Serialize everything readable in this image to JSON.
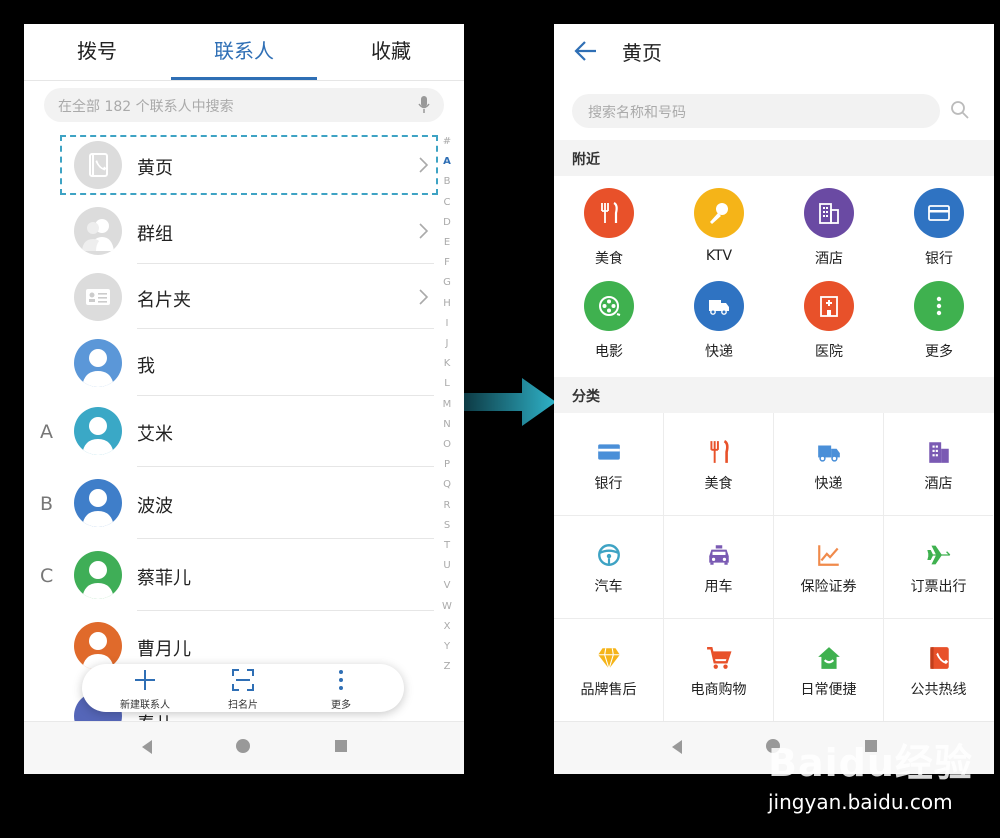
{
  "left": {
    "tabs": [
      {
        "label": "拨号"
      },
      {
        "label": "联系人"
      },
      {
        "label": "收藏"
      }
    ],
    "search_placeholder": "在全部 182 个联系人中搜索",
    "rows": [
      {
        "name": "黄页",
        "letter": "",
        "icon": "yellow-pages-icon"
      },
      {
        "name": "群组",
        "letter": "",
        "icon": "group-icon"
      },
      {
        "name": "名片夹",
        "letter": "",
        "icon": "business-card-icon"
      },
      {
        "name": "我",
        "letter": "",
        "icon": "person-avatar"
      },
      {
        "name": "艾米",
        "letter": "A",
        "icon": "person-avatar"
      },
      {
        "name": "波波",
        "letter": "B",
        "icon": "person-avatar"
      },
      {
        "name": "蔡菲儿",
        "letter": "C",
        "icon": "person-avatar"
      },
      {
        "name": "曹月儿",
        "letter": "",
        "icon": "person-avatar"
      },
      {
        "name": "春儿",
        "letter": "",
        "icon": "person-avatar"
      }
    ],
    "index_letters": [
      "#",
      "A",
      "B",
      "C",
      "D",
      "E",
      "F",
      "G",
      "H",
      "I",
      "J",
      "K",
      "L",
      "M",
      "N",
      "O",
      "P",
      "Q",
      "R",
      "S",
      "T",
      "U",
      "V",
      "W",
      "X",
      "Y",
      "Z"
    ],
    "active_index": "A",
    "bottom_actions": [
      {
        "label": "新建联系人",
        "icon": "plus-icon"
      },
      {
        "label": "扫名片",
        "icon": "scan-icon"
      },
      {
        "label": "更多",
        "icon": "more-icon"
      }
    ]
  },
  "right": {
    "title": "黄页",
    "search_placeholder": "搜索名称和号码",
    "nearby": {
      "title": "附近",
      "items": [
        {
          "label": "美食",
          "icon": "fork-knife-icon",
          "color": "#e8512a"
        },
        {
          "label": "KTV",
          "icon": "microphone-icon",
          "color": "#f5b418"
        },
        {
          "label": "酒店",
          "icon": "hotel-icon",
          "color": "#6a4aa3"
        },
        {
          "label": "银行",
          "icon": "bank-card-icon",
          "color": "#2f73c2"
        },
        {
          "label": "电影",
          "icon": "film-reel-icon",
          "color": "#3fb14f"
        },
        {
          "label": "快递",
          "icon": "delivery-truck-icon",
          "color": "#2f73c2"
        },
        {
          "label": "医院",
          "icon": "hospital-icon",
          "color": "#e8512a"
        },
        {
          "label": "更多",
          "icon": "more-icon",
          "color": "#3fb14f"
        }
      ]
    },
    "categories": {
      "title": "分类",
      "items": [
        {
          "label": "银行",
          "icon": "bank-card-icon",
          "color": "#4a8fd8"
        },
        {
          "label": "美食",
          "icon": "fork-knife-icon",
          "color": "#e8512a"
        },
        {
          "label": "快递",
          "icon": "delivery-truck-icon",
          "color": "#4a8fd8"
        },
        {
          "label": "酒店",
          "icon": "hotel-icon",
          "color": "#7a5ab3"
        },
        {
          "label": "汽车",
          "icon": "steering-wheel-icon",
          "color": "#3ea3c4"
        },
        {
          "label": "用车",
          "icon": "taxi-icon",
          "color": "#7a5ab3"
        },
        {
          "label": "保险证券",
          "icon": "stock-chart-icon",
          "color": "#f08a4b"
        },
        {
          "label": "订票出行",
          "icon": "airplane-icon",
          "color": "#3fb14f"
        },
        {
          "label": "品牌售后",
          "icon": "diamond-icon",
          "color": "#f5b418"
        },
        {
          "label": "电商购物",
          "icon": "shopping-cart-icon",
          "color": "#e8512a"
        },
        {
          "label": "日常便捷",
          "icon": "home-icon",
          "color": "#3fb14f"
        },
        {
          "label": "公共热线",
          "icon": "phone-book-icon",
          "color": "#e8512a"
        }
      ]
    }
  },
  "watermark": {
    "logo": "Baidu经验",
    "url": "jingyan.baidu.com"
  }
}
